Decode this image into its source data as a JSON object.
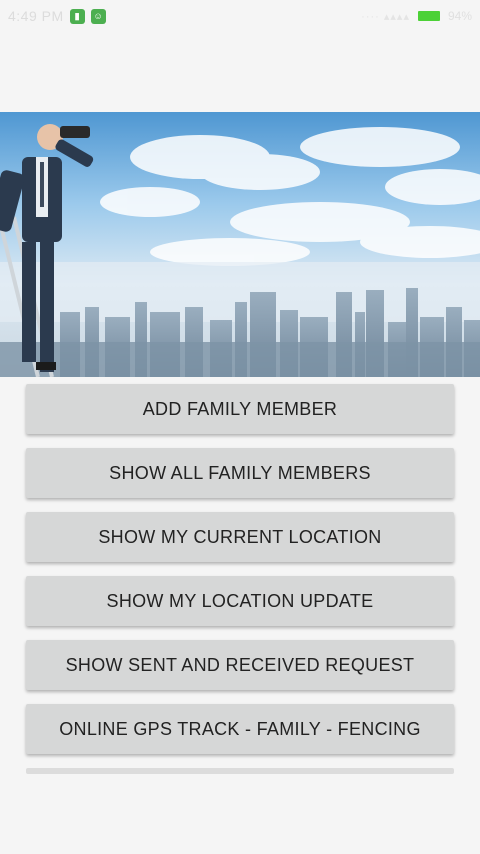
{
  "status_bar": {
    "time": "4:49 PM",
    "battery_text": "94%",
    "notification_icons": [
      "sim-icon",
      "android-icon"
    ]
  },
  "hero": {
    "image": "businessman-on-ladder-with-binoculars-over-city-skyline"
  },
  "menu": {
    "items": [
      {
        "label": "ADD FAMILY MEMBER"
      },
      {
        "label": "SHOW ALL FAMILY MEMBERS"
      },
      {
        "label": "SHOW MY CURRENT LOCATION"
      },
      {
        "label": "SHOW MY LOCATION UPDATE"
      },
      {
        "label": "SHOW SENT AND RECEIVED REQUEST"
      },
      {
        "label": "ONLINE GPS TRACK - FAMILY - FENCING"
      }
    ]
  },
  "colors": {
    "background": "#f5f5f5",
    "button_bg": "#d6d7d7",
    "button_text": "#222222",
    "battery": "#4cd137",
    "notif_icon": "#4caf50"
  }
}
